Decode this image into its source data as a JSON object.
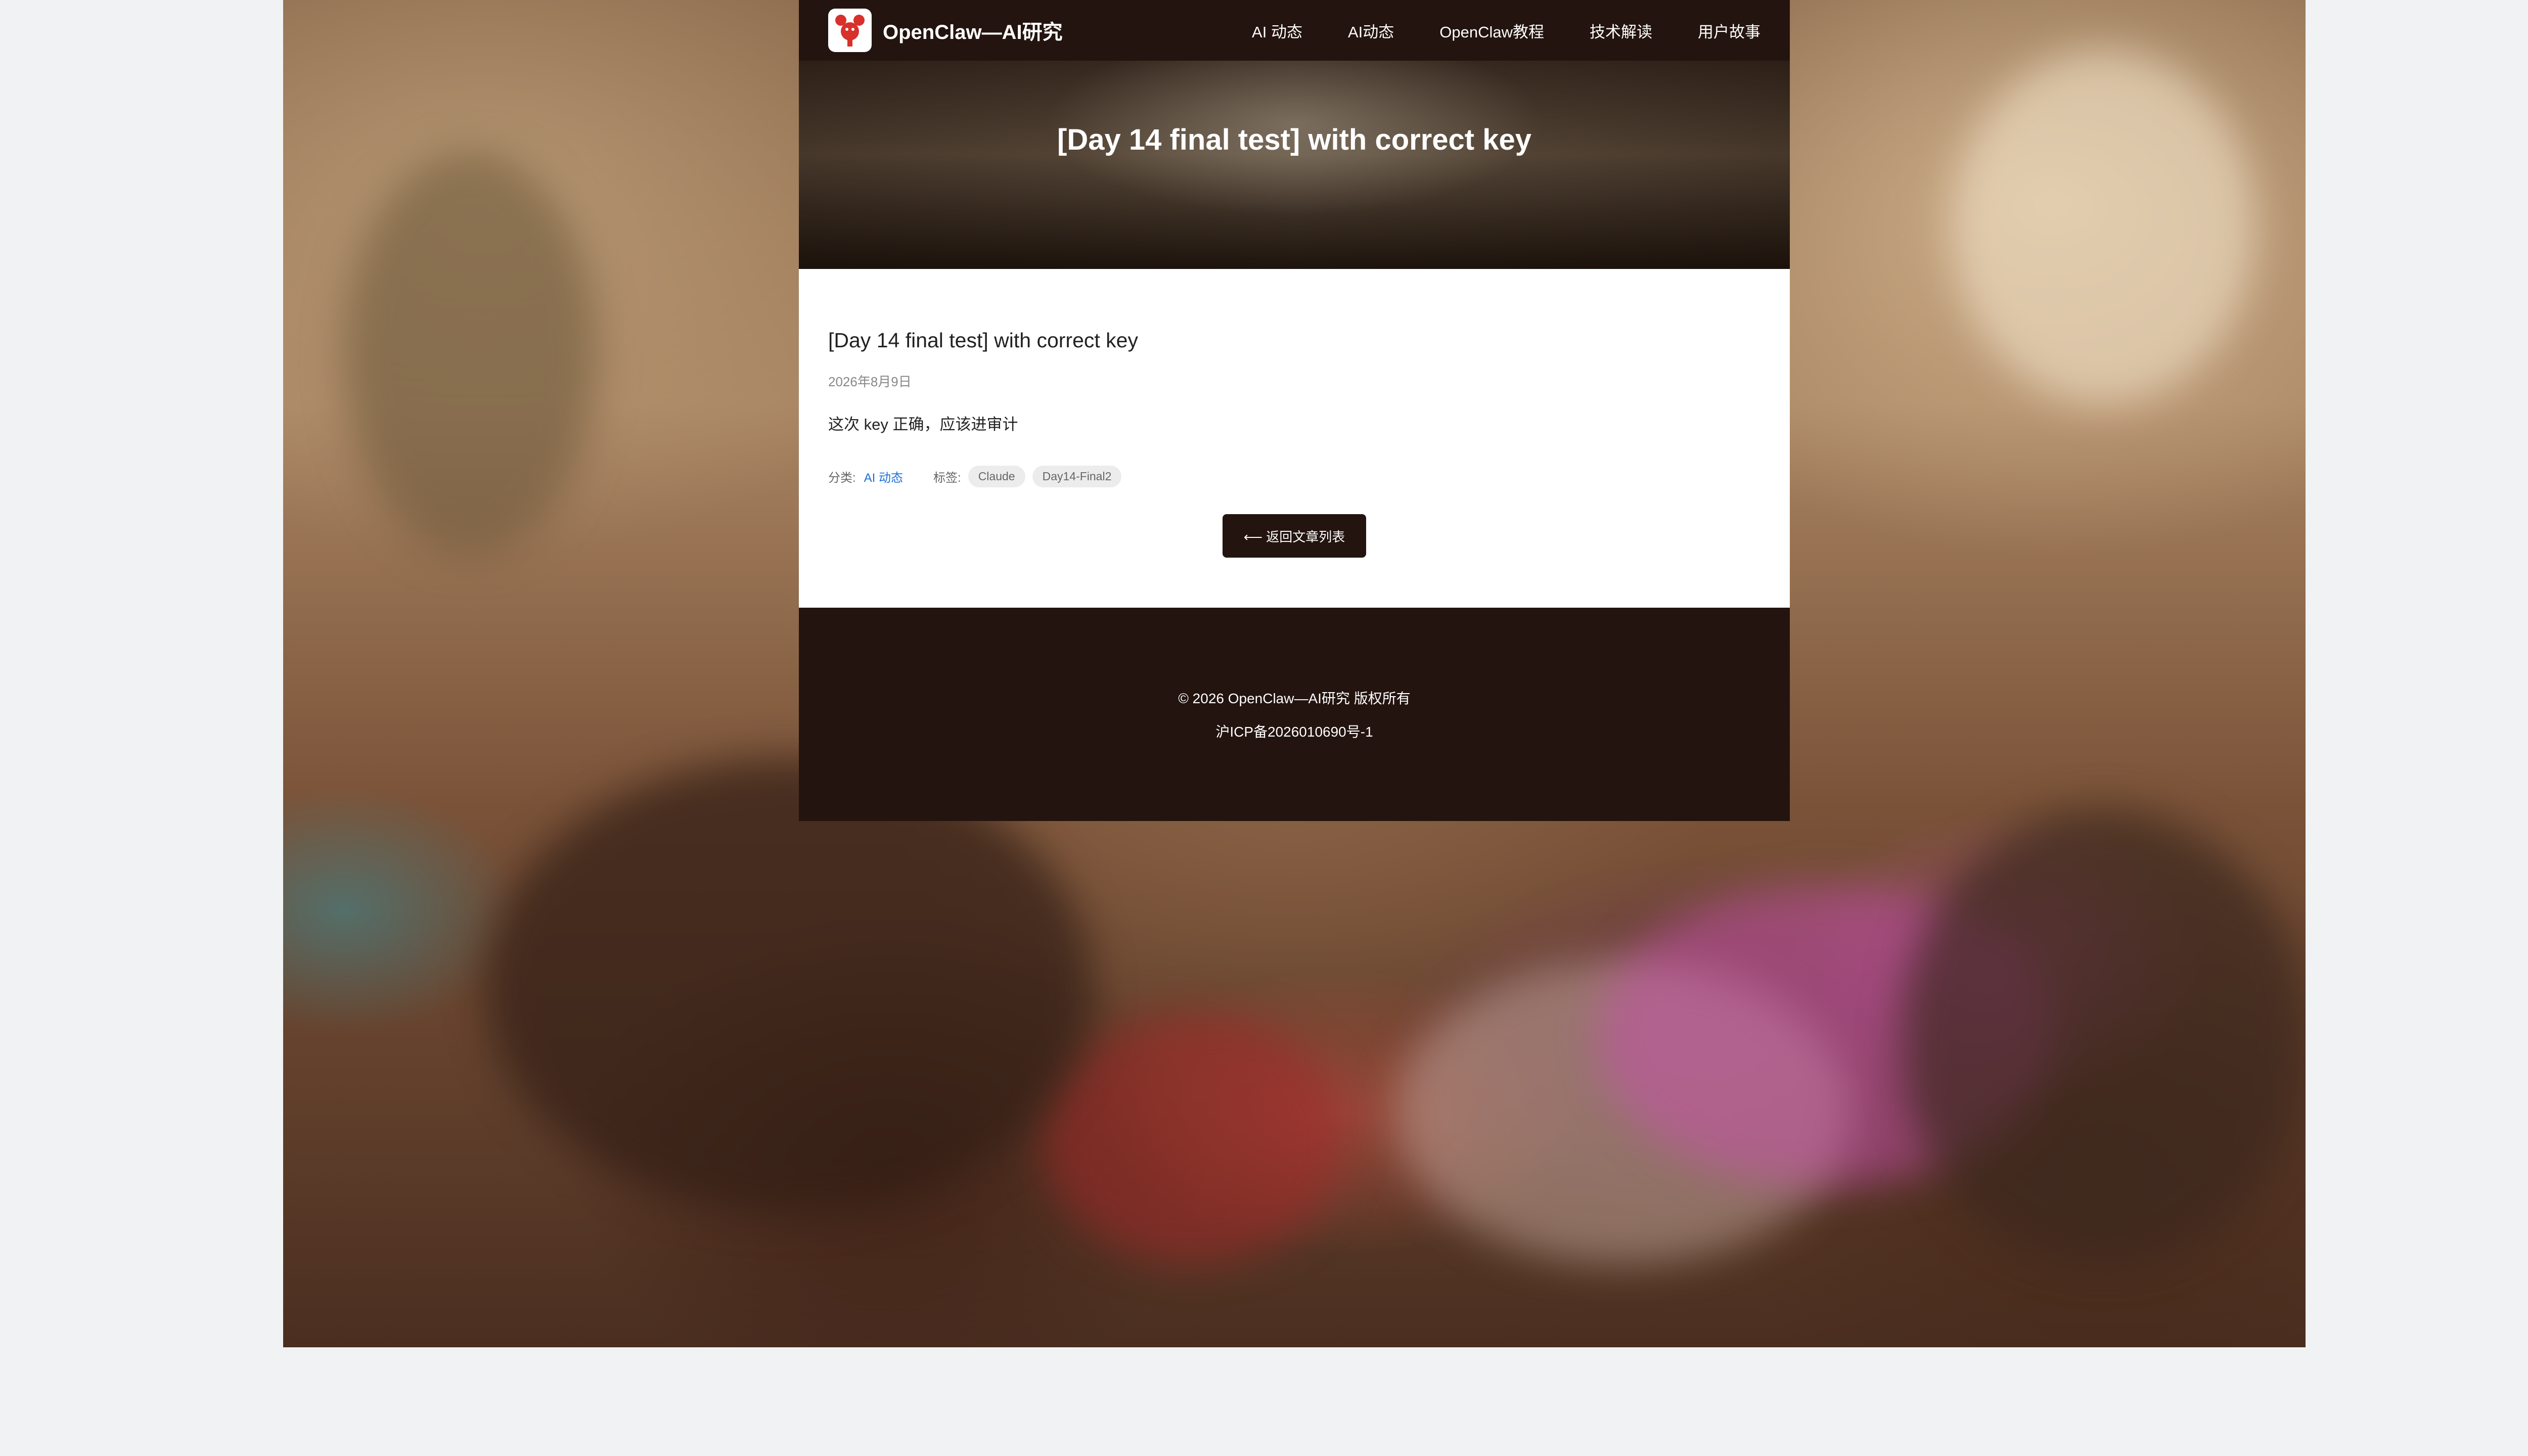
{
  "navbar": {
    "brand": "OpenClaw—AI研究",
    "logo_icon": "lobster-logo-icon",
    "items": [
      {
        "label": "AI 动态"
      },
      {
        "label": "AI动态"
      },
      {
        "label": "OpenClaw教程"
      },
      {
        "label": "技术解读"
      },
      {
        "label": "用户故事"
      }
    ]
  },
  "hero": {
    "title": "[Day 14 final test] with correct key"
  },
  "article": {
    "title": "[Day 14 final test] with correct key",
    "date": "2026年8月9日",
    "body": "这次 key 正确，应该进审计",
    "category_label": "分类:",
    "category": "AI 动态",
    "tags_label": "标签:",
    "tags": [
      "Claude",
      "Day14-Final2"
    ],
    "back_button": "⟵ 返回文章列表"
  },
  "footer": {
    "copyright": "© 2026 OpenClaw—AI研究 版权所有",
    "icp": "沪ICP备2026010690号-1"
  },
  "colors": {
    "nav_bg": "#23140f",
    "link": "#1a6fd6",
    "page_bg": "#f1f2f3"
  }
}
